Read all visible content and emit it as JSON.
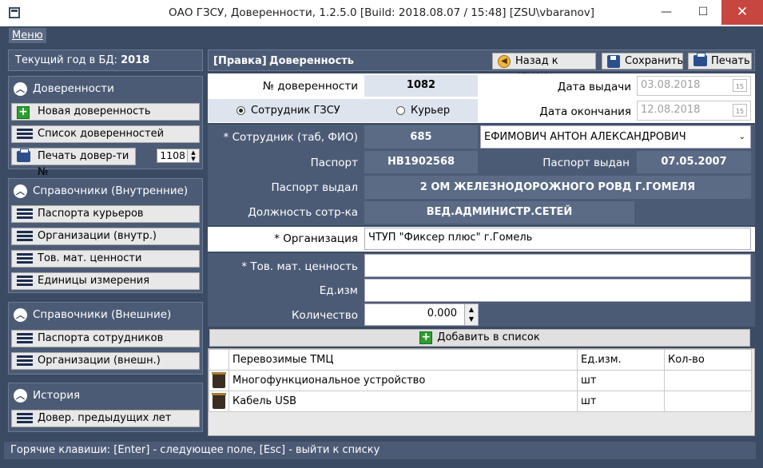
{
  "window": {
    "title": "ОАО ГЗСУ, Доверенности, 1.2.5.0 [Build: 2018.08.07 / 15:48] [ZSU\\vbaranov]",
    "minimize": "—",
    "maximize": "☐",
    "close": "✕"
  },
  "menu": {
    "label": "Меню"
  },
  "left": {
    "year_label": "Текущий год в БД:",
    "year_value": "2018",
    "groups": [
      {
        "title": "Доверенности",
        "items": [
          "Новая доверенность",
          "Список доверенностей",
          "Печать довер-ти №"
        ],
        "print_number": "1108"
      },
      {
        "title": "Справочники (Внутренние)",
        "items": [
          "Паспорта курьеров",
          "Организации (внутр.)",
          "Тов. мат. ценности",
          "Единицы измерения"
        ]
      },
      {
        "title": "Справочники (Внешние)",
        "items": [
          "Паспорта сотрудников",
          "Организации (внешн.)"
        ]
      },
      {
        "title": "История",
        "items": [
          "Довер. предыдущих лет"
        ]
      }
    ]
  },
  "right": {
    "crumb_edit": "[Правка]",
    "crumb_title": "Доверенность",
    "buttons": {
      "back": "Назад к списку",
      "save": "Сохранить",
      "print": "Печать"
    },
    "doc_number_label": "№ доверенности",
    "doc_number": "1082",
    "issue_date_label": "Дата выдачи",
    "issue_date": "03.08.2018",
    "end_date_label": "Дата окончания",
    "end_date": "12.08.2018",
    "radio_employee": "Сотрудник ГЗСУ",
    "radio_courier": "Курьер",
    "employee_label": "* Сотрудник (таб, ФИО)",
    "employee_tab": "685",
    "employee_name": "ЕФИМОВИЧ АНТОН АЛЕКСАНДРОВИЧ",
    "passport_label": "Паспорт",
    "passport": "НВ1902568",
    "passport_issued_label": "Паспорт выдан",
    "passport_issued": "07.05.2007",
    "issued_by_label": "Паспорт выдал",
    "issued_by": "2 ОМ ЖЕЛЕЗНОДОРОЖНОГО РОВД Г.ГОМЕЛЯ",
    "position_label": "Должность сотр-ка",
    "position": "ВЕД.АДМИНИСТР.СЕТЕЙ",
    "org_label": "* Организация",
    "org": "ЧТУП \"Фиксер плюс\" г.Гомель",
    "goods_label": "* Тов. мат. ценность",
    "unit_label": "Ед.изм",
    "qty_label": "Количество",
    "qty": "0.000",
    "add_button": "Добавить в список",
    "table": {
      "headers": [
        "Перевозимые ТМЦ",
        "Ед.изм.",
        "Кол-во"
      ],
      "rows": [
        {
          "name": "Многофункциональное устройство",
          "unit": "шт",
          "qty": ""
        },
        {
          "name": "Кабель USB",
          "unit": "шт",
          "qty": ""
        }
      ]
    }
  },
  "status": "Горячие клавиши: [Enter] - следующее поле, [Esc] - выйти к списку"
}
